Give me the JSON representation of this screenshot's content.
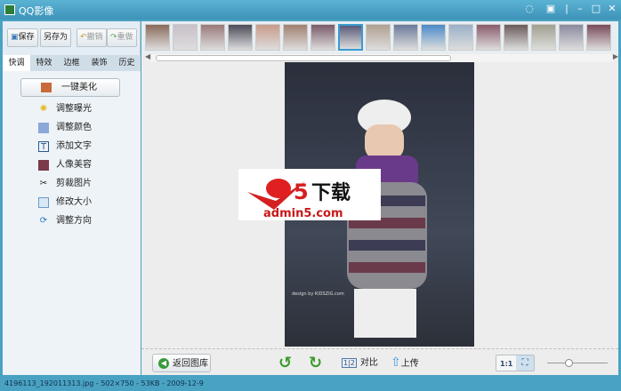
{
  "window": {
    "title": "QQ影像",
    "controls": [
      "feedback",
      "menu",
      "minimize",
      "maximize",
      "close"
    ]
  },
  "toolbar": {
    "save": "保存",
    "save_as": "另存为",
    "undo": "撤销",
    "redo": "重做"
  },
  "tabs": [
    "快调",
    "特效",
    "边框",
    "装饰",
    "历史"
  ],
  "panel": {
    "one_click": "一键美化",
    "items": [
      "调整曝光",
      "调整颜色",
      "添加文字",
      "人像美容",
      "剪裁图片",
      "修改大小",
      "调整方向"
    ]
  },
  "thumbnails": {
    "count": 17,
    "selected_index": 7
  },
  "watermark": {
    "brand": "a5下载",
    "url": "admin5.com"
  },
  "photo_caption": "design by KIDSZIG.com",
  "bottom": {
    "back": "返回图库",
    "compare": "对比",
    "upload": "上传",
    "actual_size": "1:1",
    "zoom_level": 0.15
  },
  "status": "4196113_192011313.jpg - 502×750 - 53KB - 2009-12-9",
  "colors": {
    "title_bar": "#3d93b8",
    "status_bar": "#4aa2c3",
    "selected": "#3a9ad0"
  }
}
